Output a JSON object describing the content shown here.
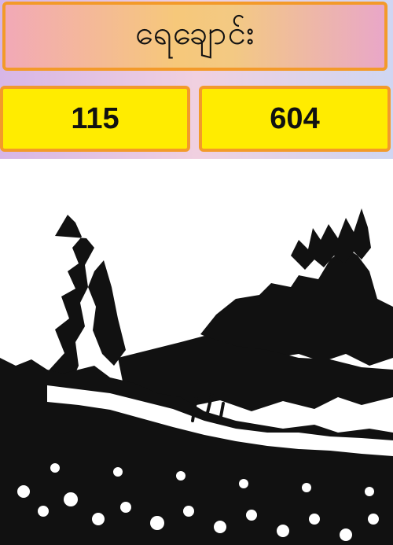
{
  "header": {
    "title": "ရေချောင်း"
  },
  "numbers": {
    "left": "115",
    "right": "604"
  },
  "image": {
    "subject": "river-landscape-illustration"
  },
  "colors": {
    "accent_border": "#f39a2a",
    "number_box_fill": "#ffec00"
  }
}
